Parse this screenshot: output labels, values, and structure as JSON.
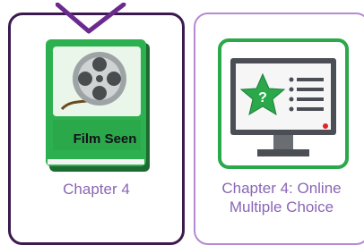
{
  "items": [
    {
      "label": "Chapter 4",
      "selected": true,
      "icon": "film-reel-book-icon",
      "icon_text": "Film Seen"
    },
    {
      "label_lines": [
        "Chapter 4: Online",
        "Multiple Choice"
      ],
      "selected": false,
      "icon": "online-quiz-monitor-icon"
    }
  ],
  "colors": {
    "selected_border": "#3b1a4e",
    "card_border": "#b58ad0",
    "label_text": "#8a66b4",
    "book_green": "#28a84a",
    "check_purple": "#6a2a8e"
  }
}
